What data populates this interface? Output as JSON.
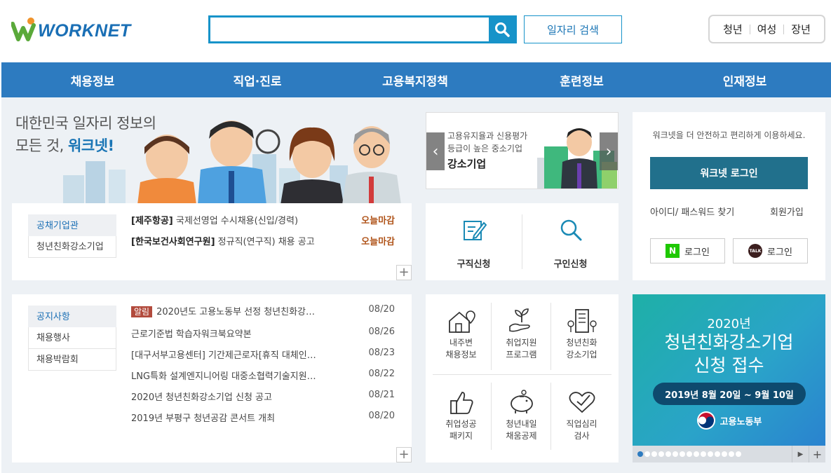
{
  "header": {
    "logo_text": "WORKNET",
    "search_placeholder": "",
    "job_search_label": "일자리 검색",
    "quick_links": [
      "청년",
      "여성",
      "장년"
    ]
  },
  "nav": [
    "채용정보",
    "직업·진로",
    "고용복지정책",
    "훈련정보",
    "인재정보"
  ],
  "hero": {
    "line1": "대한민국 일자리 정보의",
    "line2_prefix": "모든 것, ",
    "line2_highlight": "워크넷!"
  },
  "public_enterprise": {
    "tabs": [
      "공채기업관",
      "청년친화강소기업"
    ],
    "jobs": [
      {
        "company": "[제주항공]",
        "title": "국제선영업 수시채용(신입/경력)",
        "due": "오늘마감"
      },
      {
        "company": "[한국보건사회연구원]",
        "title": "정규직(연구직) 채용 공고",
        "due": "오늘마감"
      }
    ]
  },
  "notices": {
    "tabs": [
      "공지사항",
      "채용행사",
      "채용박람회"
    ],
    "badge": "알림",
    "items": [
      {
        "title": "2020년도 고용노동부 선정 청년친화강…",
        "date": "08/20"
      },
      {
        "title": "근로기준법 학습자워크북요약본",
        "date": "08/26"
      },
      {
        "title": "[대구서부고용센터] 기간제근로자[휴직 대체인…",
        "date": "08/23"
      },
      {
        "title": "LNG특화 설계엔지니어링 대중소협력기술지원…",
        "date": "08/22"
      },
      {
        "title": "2020년 청년친화강소기업 신청 공고",
        "date": "08/21"
      },
      {
        "title": "2019년 부평구 청년공감 콘서트 개최",
        "date": "08/20"
      }
    ]
  },
  "banner": {
    "line1": "고용유지율과 신용평가",
    "line2": "등급이 높은 중소기업",
    "title": "강소기업"
  },
  "apply": {
    "seek_label": "구직신청",
    "hire_label": "구인신청"
  },
  "services": [
    {
      "line1": "내주변",
      "line2": "채용정보"
    },
    {
      "line1": "취업지원",
      "line2": "프로그램"
    },
    {
      "line1": "청년친화",
      "line2": "강소기업"
    },
    {
      "line1": "취업성공",
      "line2": "패키지"
    },
    {
      "line1": "청년내일",
      "line2": "채움공제"
    },
    {
      "line1": "직업심리",
      "line2": "검사"
    }
  ],
  "login": {
    "description": "워크넷을 더 안전하고 편리하게 이용하세요.",
    "login_button": "워크넷 로그인",
    "find_id_pw": "아이디/ 패스워드 찾기",
    "signup": "회원가입",
    "naver_icon": "N",
    "naver_login": "로그인",
    "kakao_icon": "TALK",
    "kakao_login": "로그인"
  },
  "promo": {
    "year": "2020년",
    "title1": "청년친화강소기업",
    "title2": "신청 접수",
    "period": "2019년 8월 20일 ~ 9월 10일",
    "org": "고용노동부",
    "dots": 15,
    "active_dot": 0
  },
  "colors": {
    "accent": "#2d7bc0",
    "search_border": "#1793c9",
    "login_button": "#21708c",
    "deadline": "#b0541a"
  }
}
